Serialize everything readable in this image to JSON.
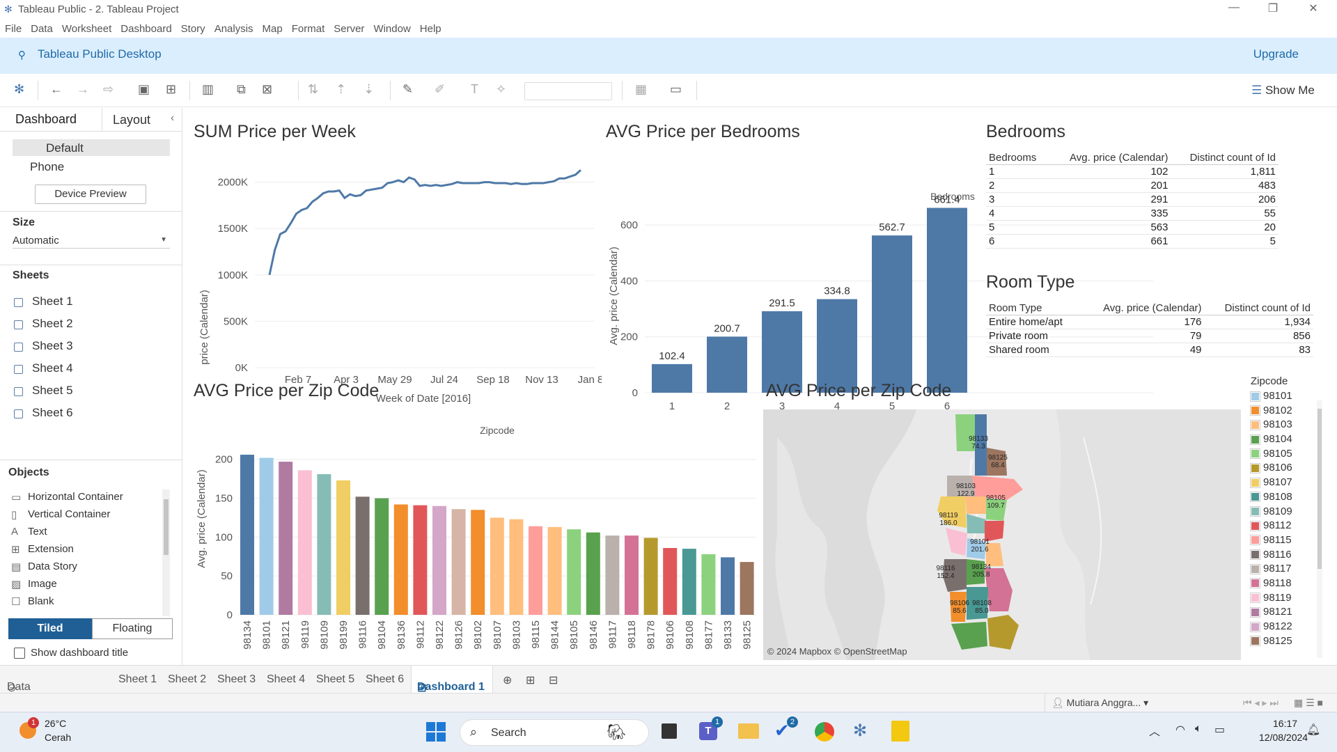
{
  "window": {
    "title": "Tableau Public - 2. Tableau Project"
  },
  "menu": [
    "File",
    "Data",
    "Worksheet",
    "Dashboard",
    "Story",
    "Analysis",
    "Map",
    "Format",
    "Server",
    "Window",
    "Help"
  ],
  "banner": {
    "title": "Tableau Public Desktop",
    "upgrade": "Upgrade"
  },
  "toolbar": {
    "show_me": "Show Me"
  },
  "left": {
    "tabs": [
      "Dashboard",
      "Layout"
    ],
    "devices": [
      "Default",
      "Phone"
    ],
    "device_preview": "Device Preview",
    "size_label": "Size",
    "size_value": "Automatic",
    "sheets_label": "Sheets",
    "sheets": [
      "Sheet 1",
      "Sheet 2",
      "Sheet 3",
      "Sheet 4",
      "Sheet 5",
      "Sheet 6"
    ],
    "objects_label": "Objects",
    "objects": [
      "Horizontal Container",
      "Vertical Container",
      "Text",
      "Extension",
      "Data Story",
      "Image",
      "Blank"
    ],
    "tiled": "Tiled",
    "floating": "Floating",
    "show_title": "Show dashboard title"
  },
  "charts": {
    "line_title": "SUM Price per Week",
    "line_ylabel": "price (Calendar)",
    "line_xlabel": "Week of Date [2016]",
    "bed_title": "AVG Price per Bedrooms",
    "bed_header": "Bedrooms",
    "bed_ylabel": "Avg. price (Calendar)",
    "zip_title": "AVG Price per Zip Code",
    "zip_header": "Zipcode",
    "zip_ylabel": "Avg. price (Calendar)",
    "map_title": "AVG Price per Zip Code",
    "map_credit": "© 2024 Mapbox © OpenStreetMap"
  },
  "bedrooms_table": {
    "title": "Bedrooms",
    "headers": [
      "Bedrooms",
      "Avg. price (Calendar)",
      "Distinct count of Id"
    ],
    "rows": [
      [
        "1",
        "102",
        "1,811"
      ],
      [
        "2",
        "201",
        "483"
      ],
      [
        "3",
        "291",
        "206"
      ],
      [
        "4",
        "335",
        "55"
      ],
      [
        "5",
        "563",
        "20"
      ],
      [
        "6",
        "661",
        "5"
      ]
    ]
  },
  "roomtype_table": {
    "title": "Room Type",
    "headers": [
      "Room Type",
      "Avg. price (Calendar)",
      "Distinct count of Id"
    ],
    "rows": [
      [
        "Entire home/apt",
        "176",
        "1,934"
      ],
      [
        "Private room",
        "79",
        "856"
      ],
      [
        "Shared room",
        "49",
        "83"
      ]
    ]
  },
  "legend": {
    "title": "Zipcode",
    "items": [
      {
        "zip": "98101",
        "color": "#a0cbe8"
      },
      {
        "zip": "98102",
        "color": "#f28e2b"
      },
      {
        "zip": "98103",
        "color": "#ffbe7d"
      },
      {
        "zip": "98104",
        "color": "#59a14f"
      },
      {
        "zip": "98105",
        "color": "#8cd17d"
      },
      {
        "zip": "98106",
        "color": "#b6992d"
      },
      {
        "zip": "98107",
        "color": "#f1ce63"
      },
      {
        "zip": "98108",
        "color": "#499894"
      },
      {
        "zip": "98109",
        "color": "#86bcb6"
      },
      {
        "zip": "98112",
        "color": "#e15759"
      },
      {
        "zip": "98115",
        "color": "#ff9d9a"
      },
      {
        "zip": "98116",
        "color": "#79706e"
      },
      {
        "zip": "98117",
        "color": "#bab0ac"
      },
      {
        "zip": "98118",
        "color": "#d37295"
      },
      {
        "zip": "98119",
        "color": "#fabfd2"
      },
      {
        "zip": "98121",
        "color": "#b07aa1"
      },
      {
        "zip": "98122",
        "color": "#d4a6c8"
      },
      {
        "zip": "98125",
        "color": "#9d7660"
      }
    ]
  },
  "map_labels": [
    {
      "zip": "98133",
      "val": "74.3"
    },
    {
      "zip": "98125",
      "val": "68.4"
    },
    {
      "zip": "98103",
      "val": "122.9"
    },
    {
      "zip": "98105",
      "val": "109.7"
    },
    {
      "zip": "98119",
      "val": "186.0"
    },
    {
      "zip": "98101",
      "val": "201.6"
    },
    {
      "zip": "98116",
      "val": "152.4"
    },
    {
      "zip": "98134",
      "val": "205.8"
    },
    {
      "zip": "98106",
      "val": "85.6"
    },
    {
      "zip": "98108",
      "val": "85.0"
    }
  ],
  "bottom_tabs": [
    "Data Source",
    "Sheet 1",
    "Sheet 2",
    "Sheet 3",
    "Sheet 4",
    "Sheet 5",
    "Sheet 6",
    "Dashboard 1"
  ],
  "status": {
    "user": "Mutiara Anggra..."
  },
  "taskbar": {
    "temp": "26°C",
    "weather": "Cerah",
    "search": "Search",
    "time": "16:17",
    "date": "12/08/2024",
    "badge1": "1",
    "badge_teams": "1",
    "badge_todo": "2"
  },
  "chart_data": [
    {
      "type": "line",
      "title": "SUM Price per Week",
      "xlabel": "Week of Date [2016]",
      "ylabel": "price (Calendar)",
      "x_ticks": [
        "Feb 7",
        "Apr 3",
        "May 29",
        "Jul 24",
        "Sep 18",
        "Nov 13",
        "Jan 8"
      ],
      "y_ticks": [
        "0K",
        "500K",
        "1000K",
        "1500K",
        "2000K"
      ],
      "ylim": [
        0,
        2200000
      ],
      "y": [
        1000000,
        1270000,
        1440000,
        1470000,
        1560000,
        1660000,
        1700000,
        1720000,
        1790000,
        1830000,
        1880000,
        1900000,
        1900000,
        1910000,
        1830000,
        1870000,
        1850000,
        1860000,
        1910000,
        1920000,
        1930000,
        1940000,
        1990000,
        2000000,
        2020000,
        2000000,
        2050000,
        2030000,
        1960000,
        1970000,
        1960000,
        1970000,
        1960000,
        1970000,
        1980000,
        2000000,
        1990000,
        1990000,
        1990000,
        1990000,
        2000000,
        2000000,
        1990000,
        1990000,
        1990000,
        1980000,
        1990000,
        1980000,
        1980000,
        1990000,
        1990000,
        1990000,
        2000000,
        2010000,
        2040000,
        2040000,
        2060000,
        2080000,
        2130000
      ]
    },
    {
      "type": "bar",
      "title": "AVG Price per Bedrooms",
      "xlabel": "Bedrooms",
      "ylabel": "Avg. price (Calendar)",
      "categories": [
        "1",
        "2",
        "3",
        "4",
        "5",
        "6"
      ],
      "values": [
        102.4,
        200.7,
        291.5,
        334.8,
        562.7,
        661.4
      ],
      "ylim": [
        0,
        720
      ],
      "y_ticks": [
        "0",
        "200",
        "400",
        "600"
      ]
    },
    {
      "type": "bar",
      "title": "AVG Price per Zip Code",
      "xlabel": "Zipcode",
      "ylabel": "Avg. price (Calendar)",
      "categories": [
        "98134",
        "98101",
        "98121",
        "98119",
        "98109",
        "98199",
        "98116",
        "98104",
        "98136",
        "98112",
        "98122",
        "98126",
        "98102",
        "98107",
        "98103",
        "98115",
        "98144",
        "98105",
        "98146",
        "98117",
        "98118",
        "98178",
        "98106",
        "98108",
        "98177",
        "98133",
        "98125"
      ],
      "values": [
        206,
        202,
        197,
        186,
        181,
        173,
        152,
        150,
        142,
        141,
        140,
        136,
        135,
        125,
        123,
        114,
        113,
        110,
        106,
        102,
        102,
        99,
        86,
        85,
        78,
        74,
        68
      ],
      "colors": [
        "#4e79a7",
        "#a0cbe8",
        "#b07aa1",
        "#fabfd2",
        "#86bcb6",
        "#f1ce63",
        "#79706e",
        "#59a14f",
        "#f28e2b",
        "#e15759",
        "#d4a6c8",
        "#d7b5a6",
        "#f28e2b",
        "#ffbe7d",
        "#ffbe7d",
        "#ff9d9a",
        "#ffbe7d",
        "#8cd17d",
        "#59a14f",
        "#bab0ac",
        "#d37295",
        "#b6992d",
        "#e15759",
        "#499894",
        "#8cd17d",
        "#4e79a7",
        "#9d7660"
      ],
      "ylim": [
        0,
        215
      ],
      "y_ticks": [
        "0",
        "50",
        "100",
        "150",
        "200"
      ]
    }
  ]
}
